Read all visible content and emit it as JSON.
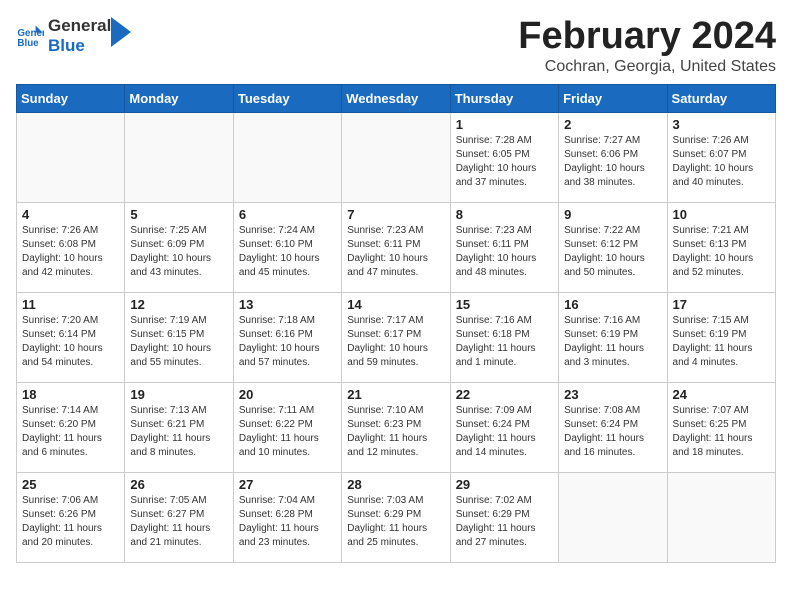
{
  "header": {
    "logo_line1": "General",
    "logo_line2": "Blue",
    "month_year": "February 2024",
    "location": "Cochran, Georgia, United States"
  },
  "weekdays": [
    "Sunday",
    "Monday",
    "Tuesday",
    "Wednesday",
    "Thursday",
    "Friday",
    "Saturday"
  ],
  "weeks": [
    [
      {
        "day": "",
        "sunrise": "",
        "sunset": "",
        "daylight": ""
      },
      {
        "day": "",
        "sunrise": "",
        "sunset": "",
        "daylight": ""
      },
      {
        "day": "",
        "sunrise": "",
        "sunset": "",
        "daylight": ""
      },
      {
        "day": "",
        "sunrise": "",
        "sunset": "",
        "daylight": ""
      },
      {
        "day": "1",
        "sunrise": "Sunrise: 7:28 AM",
        "sunset": "Sunset: 6:05 PM",
        "daylight": "Daylight: 10 hours and 37 minutes."
      },
      {
        "day": "2",
        "sunrise": "Sunrise: 7:27 AM",
        "sunset": "Sunset: 6:06 PM",
        "daylight": "Daylight: 10 hours and 38 minutes."
      },
      {
        "day": "3",
        "sunrise": "Sunrise: 7:26 AM",
        "sunset": "Sunset: 6:07 PM",
        "daylight": "Daylight: 10 hours and 40 minutes."
      }
    ],
    [
      {
        "day": "4",
        "sunrise": "Sunrise: 7:26 AM",
        "sunset": "Sunset: 6:08 PM",
        "daylight": "Daylight: 10 hours and 42 minutes."
      },
      {
        "day": "5",
        "sunrise": "Sunrise: 7:25 AM",
        "sunset": "Sunset: 6:09 PM",
        "daylight": "Daylight: 10 hours and 43 minutes."
      },
      {
        "day": "6",
        "sunrise": "Sunrise: 7:24 AM",
        "sunset": "Sunset: 6:10 PM",
        "daylight": "Daylight: 10 hours and 45 minutes."
      },
      {
        "day": "7",
        "sunrise": "Sunrise: 7:23 AM",
        "sunset": "Sunset: 6:11 PM",
        "daylight": "Daylight: 10 hours and 47 minutes."
      },
      {
        "day": "8",
        "sunrise": "Sunrise: 7:23 AM",
        "sunset": "Sunset: 6:11 PM",
        "daylight": "Daylight: 10 hours and 48 minutes."
      },
      {
        "day": "9",
        "sunrise": "Sunrise: 7:22 AM",
        "sunset": "Sunset: 6:12 PM",
        "daylight": "Daylight: 10 hours and 50 minutes."
      },
      {
        "day": "10",
        "sunrise": "Sunrise: 7:21 AM",
        "sunset": "Sunset: 6:13 PM",
        "daylight": "Daylight: 10 hours and 52 minutes."
      }
    ],
    [
      {
        "day": "11",
        "sunrise": "Sunrise: 7:20 AM",
        "sunset": "Sunset: 6:14 PM",
        "daylight": "Daylight: 10 hours and 54 minutes."
      },
      {
        "day": "12",
        "sunrise": "Sunrise: 7:19 AM",
        "sunset": "Sunset: 6:15 PM",
        "daylight": "Daylight: 10 hours and 55 minutes."
      },
      {
        "day": "13",
        "sunrise": "Sunrise: 7:18 AM",
        "sunset": "Sunset: 6:16 PM",
        "daylight": "Daylight: 10 hours and 57 minutes."
      },
      {
        "day": "14",
        "sunrise": "Sunrise: 7:17 AM",
        "sunset": "Sunset: 6:17 PM",
        "daylight": "Daylight: 10 hours and 59 minutes."
      },
      {
        "day": "15",
        "sunrise": "Sunrise: 7:16 AM",
        "sunset": "Sunset: 6:18 PM",
        "daylight": "Daylight: 11 hours and 1 minute."
      },
      {
        "day": "16",
        "sunrise": "Sunrise: 7:16 AM",
        "sunset": "Sunset: 6:19 PM",
        "daylight": "Daylight: 11 hours and 3 minutes."
      },
      {
        "day": "17",
        "sunrise": "Sunrise: 7:15 AM",
        "sunset": "Sunset: 6:19 PM",
        "daylight": "Daylight: 11 hours and 4 minutes."
      }
    ],
    [
      {
        "day": "18",
        "sunrise": "Sunrise: 7:14 AM",
        "sunset": "Sunset: 6:20 PM",
        "daylight": "Daylight: 11 hours and 6 minutes."
      },
      {
        "day": "19",
        "sunrise": "Sunrise: 7:13 AM",
        "sunset": "Sunset: 6:21 PM",
        "daylight": "Daylight: 11 hours and 8 minutes."
      },
      {
        "day": "20",
        "sunrise": "Sunrise: 7:11 AM",
        "sunset": "Sunset: 6:22 PM",
        "daylight": "Daylight: 11 hours and 10 minutes."
      },
      {
        "day": "21",
        "sunrise": "Sunrise: 7:10 AM",
        "sunset": "Sunset: 6:23 PM",
        "daylight": "Daylight: 11 hours and 12 minutes."
      },
      {
        "day": "22",
        "sunrise": "Sunrise: 7:09 AM",
        "sunset": "Sunset: 6:24 PM",
        "daylight": "Daylight: 11 hours and 14 minutes."
      },
      {
        "day": "23",
        "sunrise": "Sunrise: 7:08 AM",
        "sunset": "Sunset: 6:24 PM",
        "daylight": "Daylight: 11 hours and 16 minutes."
      },
      {
        "day": "24",
        "sunrise": "Sunrise: 7:07 AM",
        "sunset": "Sunset: 6:25 PM",
        "daylight": "Daylight: 11 hours and 18 minutes."
      }
    ],
    [
      {
        "day": "25",
        "sunrise": "Sunrise: 7:06 AM",
        "sunset": "Sunset: 6:26 PM",
        "daylight": "Daylight: 11 hours and 20 minutes."
      },
      {
        "day": "26",
        "sunrise": "Sunrise: 7:05 AM",
        "sunset": "Sunset: 6:27 PM",
        "daylight": "Daylight: 11 hours and 21 minutes."
      },
      {
        "day": "27",
        "sunrise": "Sunrise: 7:04 AM",
        "sunset": "Sunset: 6:28 PM",
        "daylight": "Daylight: 11 hours and 23 minutes."
      },
      {
        "day": "28",
        "sunrise": "Sunrise: 7:03 AM",
        "sunset": "Sunset: 6:29 PM",
        "daylight": "Daylight: 11 hours and 25 minutes."
      },
      {
        "day": "29",
        "sunrise": "Sunrise: 7:02 AM",
        "sunset": "Sunset: 6:29 PM",
        "daylight": "Daylight: 11 hours and 27 minutes."
      },
      {
        "day": "",
        "sunrise": "",
        "sunset": "",
        "daylight": ""
      },
      {
        "day": "",
        "sunrise": "",
        "sunset": "",
        "daylight": ""
      }
    ]
  ]
}
